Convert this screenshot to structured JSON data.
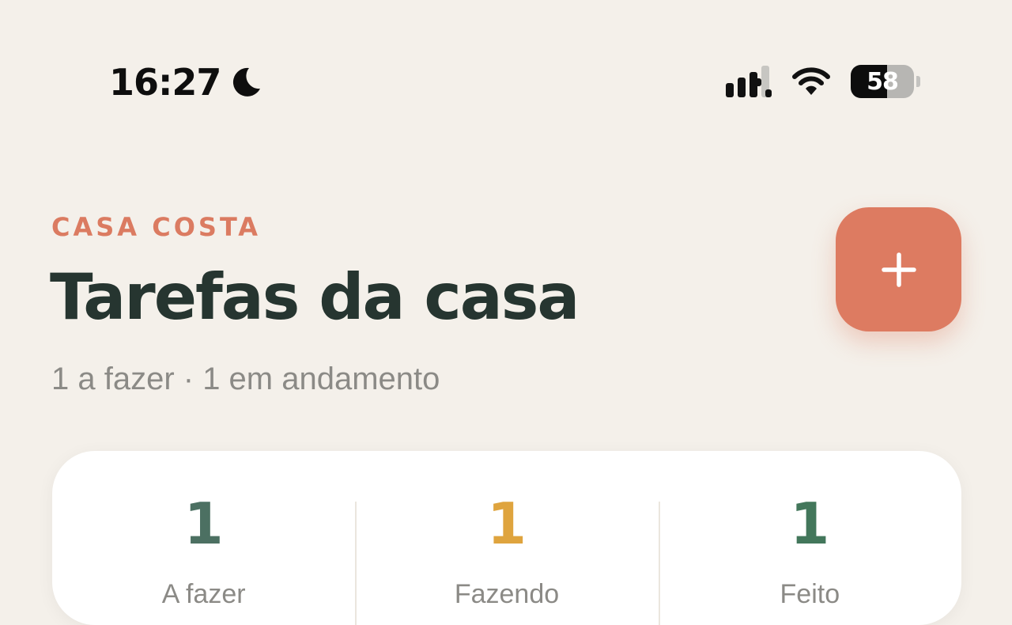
{
  "status_bar": {
    "time": "16:27",
    "focus_icon": "moon-icon",
    "signal_icon": "cellular-signal-icon",
    "wifi_icon": "wifi-icon",
    "battery_percent": "58",
    "battery_level": 0.58
  },
  "header": {
    "household": "CASA COSTA",
    "title": "Tarefas da casa",
    "summary": "1 a fazer · 1 em andamento",
    "add_button_icon": "plus-icon"
  },
  "stats": [
    {
      "value": "1",
      "label": "A fazer",
      "color": "#4c7062"
    },
    {
      "value": "1",
      "label": "Fazendo",
      "color": "#dfa43e"
    },
    {
      "value": "1",
      "label": "Feito",
      "color": "#43775b"
    }
  ],
  "colors": {
    "background": "#f4f0ea",
    "accent": "#dd7b61",
    "title": "#263530",
    "muted": "#8b8a86",
    "card": "#ffffff"
  }
}
